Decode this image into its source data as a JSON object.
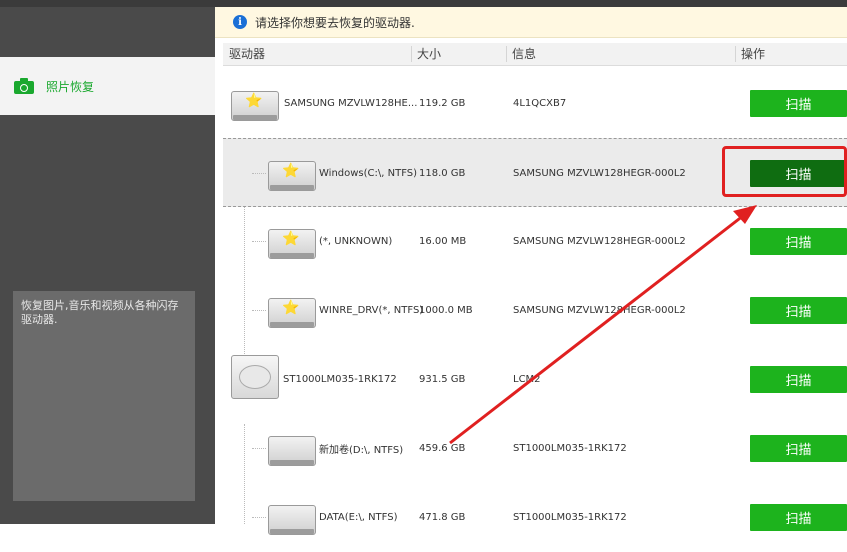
{
  "notice": {
    "text": "请选择你想要去恢复的驱动器."
  },
  "sidebar": {
    "items": [
      {
        "label": "照片恢复",
        "icon": "camera-icon"
      }
    ],
    "description": "恢复图片,音乐和视频从各种闪存驱动器."
  },
  "table": {
    "columns": [
      "驱动器",
      "大小",
      "信息",
      "操作"
    ],
    "rows": [
      {
        "name": "SAMSUNG MZVLW128HE...",
        "size": "119.2 GB",
        "info": "4L1QCXB7",
        "action": "扫描",
        "icon": "usb-drive-icon",
        "level": 0
      },
      {
        "name": "Windows(C:\\, NTFS)",
        "size": "118.0 GB",
        "info": "SAMSUNG MZVLW128HEGR-000L2",
        "action": "扫描",
        "icon": "usb-drive-icon",
        "level": 1,
        "selected": true
      },
      {
        "name": "(*, UNKNOWN)",
        "size": "16.00 MB",
        "info": "SAMSUNG MZVLW128HEGR-000L2",
        "action": "扫描",
        "icon": "usb-drive-icon",
        "level": 1
      },
      {
        "name": "WINRE_DRV(*, NTFS)",
        "size": "1000.0 MB",
        "info": "SAMSUNG MZVLW128HEGR-000L2",
        "action": "扫描",
        "icon": "usb-drive-icon",
        "level": 1
      },
      {
        "name": "ST1000LM035-1RK172",
        "size": "931.5 GB",
        "info": "LCM2",
        "action": "扫描",
        "icon": "hard-disk-icon",
        "level": 0
      },
      {
        "name": "新加卷(D:\\, NTFS)",
        "size": "459.6 GB",
        "info": "ST1000LM035-1RK172",
        "action": "扫描",
        "icon": "volume-icon",
        "level": 1
      },
      {
        "name": "DATA(E:\\, NTFS)",
        "size": "471.8 GB",
        "info": "ST1000LM035-1RK172",
        "action": "扫描",
        "icon": "volume-icon",
        "level": 1
      }
    ]
  },
  "annotation": {
    "color": "#e02020"
  },
  "colors": {
    "accent": "#1db31d",
    "active_button": "#0f6d11"
  }
}
